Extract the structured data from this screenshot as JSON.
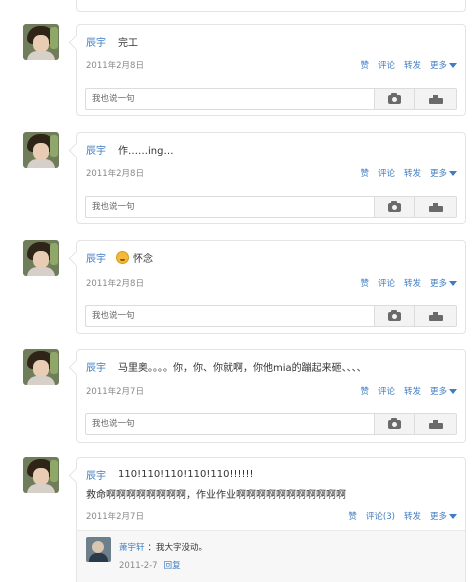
{
  "reply_placeholder": "我也说一句",
  "actions": {
    "like": "赞",
    "comment": "评论",
    "repost": "转发",
    "more": "更多"
  },
  "posts": [
    {
      "author": "辰宇",
      "text": "完工",
      "date": "2011年2月8日"
    },
    {
      "author": "辰宇",
      "text": "作……ing…",
      "date": "2011年2月8日"
    },
    {
      "author": "辰宇",
      "text": "怀念",
      "date": "2011年2月8日",
      "emoji": "smiley-face"
    },
    {
      "author": "辰宇",
      "text": "马里奥。。。。你，你、你就啊，你他mia的蹦起来砸、、、、",
      "date": "2011年2月7日"
    },
    {
      "author": "辰宇",
      "text": "110!110!110!110!110!!!!!!",
      "text_line2": "救命啊啊啊啊啊啊啊啊，作业作业啊啊啊啊啊啊啊啊啊啊啊",
      "date": "2011年2月7日",
      "comment_label": "评论(3)"
    }
  ],
  "comment": {
    "author": "萧宇轩",
    "text": "：我大字没动。",
    "date": "2011-2-7",
    "reply": "回复"
  },
  "colors": {
    "link": "#3f7cc1",
    "border": "#e4e4e4",
    "date": "#888888"
  }
}
